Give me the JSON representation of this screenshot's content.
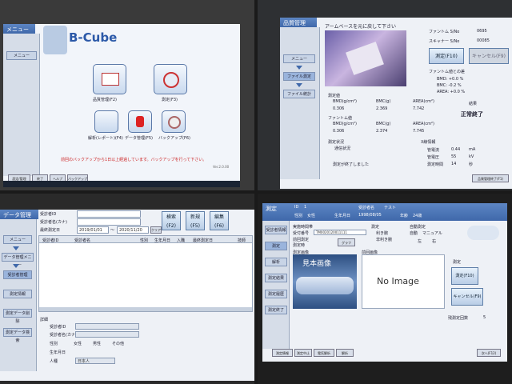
{
  "q1": {
    "menu_label": "メニュー",
    "side_menu": "メニュー",
    "logo": "B-Cube",
    "buttons": [
      {
        "label": "品質管理(F2)"
      },
      {
        "label": "測定(F3)"
      },
      {
        "label": "解析(レポート)(F4)"
      },
      {
        "label": "データ管理(F5)"
      },
      {
        "label": "バックアップ(F6)"
      }
    ],
    "notice": "前回のバックアップから1日以上経過しています。バックアップを行って下さい。",
    "version": "Ver.2.0.00",
    "fkeys": [
      "設定/管理",
      "終了",
      "ヘルプ",
      "バックアップ"
    ]
  },
  "q2": {
    "title": "品質管理",
    "side_menu": "メニュー",
    "side_items": [
      "ファイル測定",
      "ファイル統計"
    ],
    "instruction": "アームベースを元に戻して下さい",
    "phantom_sn_label": "ファントム S/No",
    "phantom_sn": "0695",
    "scanner_sn_label": "スキャナー S/No",
    "scanner_sn": "00085",
    "measure_btn": "測定(F10)",
    "cancel_btn": "キャンセル(F9)",
    "meas_label": "測定値",
    "bmd_label": "BMD(g/cm²)",
    "bmc_label": "BMC(g)",
    "area_label": "AREA(cm²)",
    "meas": {
      "bmd": "0.306",
      "bmc": "2.369",
      "area": "7.742"
    },
    "phantom_label": "ファントム値",
    "phantom": {
      "bmd": "0.306",
      "bmc": "2.374",
      "area": "7.745"
    },
    "change_label": "ファントム値との差",
    "bmd_diff": "BMD: +0.0 %",
    "bmc_diff": "BMC: -0.2 %",
    "area_diff": "AREA: +0.0 %",
    "result_label": "結果",
    "result": "正常終了",
    "status_label": "測定状況",
    "status_val": "通信状況",
    "xray_label": "X線情報",
    "tube_current_label": "管電流",
    "tube_current": "0.44",
    "tube_current_unit": "mA",
    "tube_voltage_label": "管電圧",
    "tube_voltage": "55",
    "tube_voltage_unit": "kV",
    "meas_time_label": "測定時間",
    "meas_time": "14",
    "meas_time_unit": "秒",
    "finish_msg": "測定が終了しました",
    "footer_btn": "品質管理終了(F1)"
  },
  "q3": {
    "title": "データ管理",
    "side_menu": "メニュー",
    "side_items": [
      "データ管理メニュー",
      "受診者管理",
      "測定情報",
      "測定データ削除",
      "測定データ検索"
    ],
    "patient_id_label": "受診者ID",
    "patient_name_label": "受診者名(カナ)",
    "last_date_label": "最終測定日",
    "date_from": "2019/01/01",
    "date_to": "2020/11/20",
    "clear_btn": "クリア",
    "search_btn": "検索(F2)",
    "new_btn": "新規(F5)",
    "edit_btn": "編集(F6)",
    "columns": [
      "受診者ID",
      "受診者名",
      "性別",
      "生年月日",
      "入職",
      "最終測定日",
      "技師"
    ],
    "detail_label": "詳細",
    "d_id_label": "受診者ID",
    "d_name_label": "受診者名(カナ)",
    "d_sex_label": "性別",
    "sex_options": [
      "女性",
      "男性",
      "その他"
    ],
    "d_birth_label": "生年月日",
    "d_race_label": "人種",
    "race_value": "日本人"
  },
  "q4": {
    "title": "測定",
    "id_label": "ID",
    "id_value": "1",
    "name_label": "受診者名",
    "name_value": "テスト",
    "sex_label": "性別",
    "sex_value": "女性",
    "birth_label": "生年月日",
    "birth_value": "1998/08/05",
    "age_label": "年齢",
    "age_value": "24歳",
    "facility_label": "実施時間帯",
    "reg_label": "受付番号",
    "reg_value": "TM0020120011111",
    "prev_label": "前回測定",
    "meas_date_label": "測定時",
    "graph_btn": "グラフ",
    "side_items": [
      "受診者情報",
      "測定",
      "解析",
      "測定結果",
      "測定履歴",
      "測定終了"
    ],
    "hand_label": "測定",
    "hand_opts": [
      "利き腕",
      "非利き腕"
    ],
    "mode_label": "自動測定",
    "mode_opts": [
      "自動",
      "マニュアル"
    ],
    "lr_opts": [
      "左",
      "右"
    ],
    "img_section": "測定画像",
    "ref_section": "前回画像",
    "sample_img": "見本画像",
    "no_image": "No Image",
    "measure_label": "測定",
    "measure_btn": "測定(F10)",
    "cancel_btn": "キャンセル(F9)",
    "remain_label": "残測定回数",
    "remain_value": "5",
    "footer": [
      "測定情報",
      "測定中止",
      "電気解析",
      "解析"
    ],
    "next_btn": "次へ(F12)"
  }
}
